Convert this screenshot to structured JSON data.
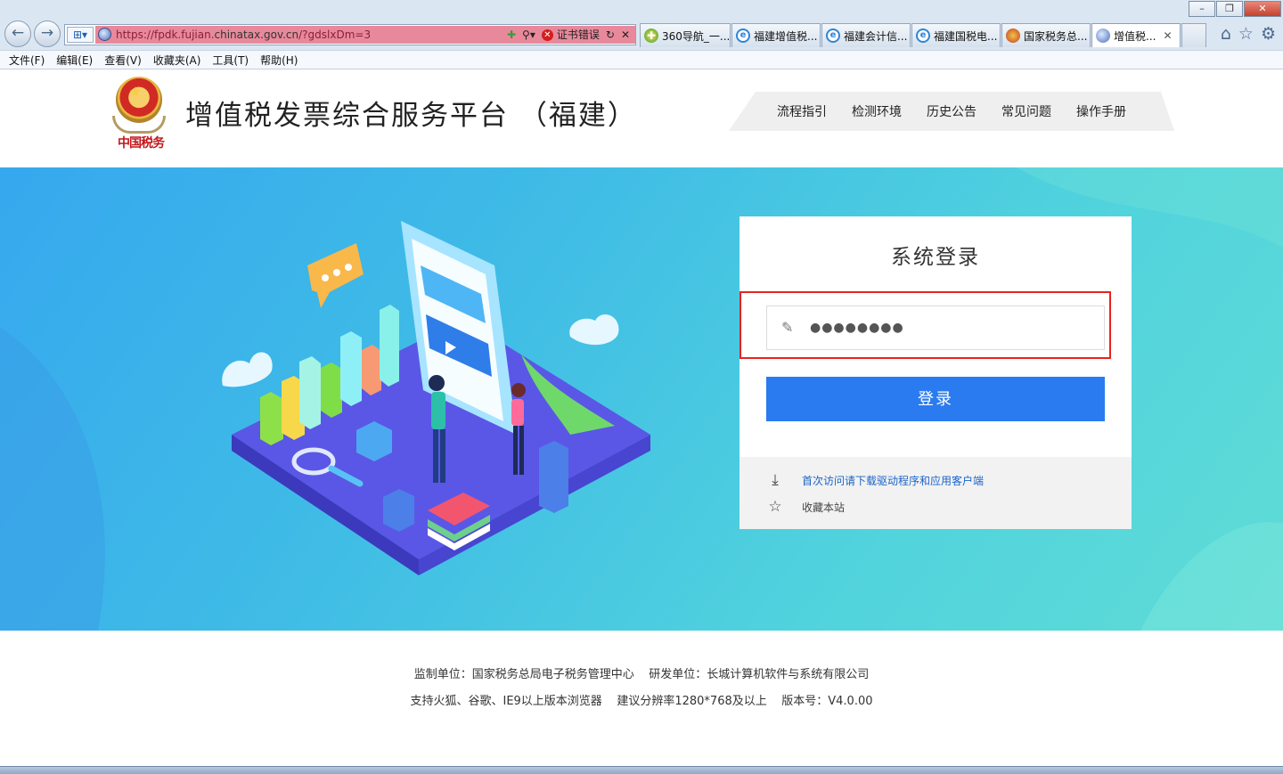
{
  "browser": {
    "address": {
      "prefix": "https://fpdk.fujian.",
      "domain": "chinatax.gov.cn",
      "path": "/?gdslxDm=3"
    },
    "cert_error": "证书错误",
    "tabs": [
      {
        "label": "360导航_一...",
        "icon": "nav"
      },
      {
        "label": "福建增值税...",
        "icon": "ie"
      },
      {
        "label": "福建会计信...",
        "icon": "ie"
      },
      {
        "label": "福建国税电...",
        "icon": "ie"
      },
      {
        "label": "国家税务总...",
        "icon": "tax"
      },
      {
        "label": "增值税...",
        "icon": "globe"
      }
    ],
    "menu": [
      "文件(F)",
      "编辑(E)",
      "查看(V)",
      "收藏夹(A)",
      "工具(T)",
      "帮助(H)"
    ]
  },
  "header": {
    "logo_text": "中国税务",
    "title": "增值税发票综合服务平台 （福建）",
    "nav": [
      "流程指引",
      "检测环境",
      "历史公告",
      "常见问题",
      "操作手册"
    ]
  },
  "login": {
    "title": "系统登录",
    "password_value": "●●●●●●●●",
    "button": "登录",
    "download_link": "首次访问请下载驱动程序和应用客户端",
    "favorite_link": "收藏本站"
  },
  "footer": {
    "line1": "监制单位：国家税务总局电子税务管理中心    研发单位：长城计算机软件与系统有限公司",
    "line2": "支持火狐、谷歌、IE9以上版本浏览器    建议分辨率1280*768及以上    版本号：V4.0.00"
  }
}
